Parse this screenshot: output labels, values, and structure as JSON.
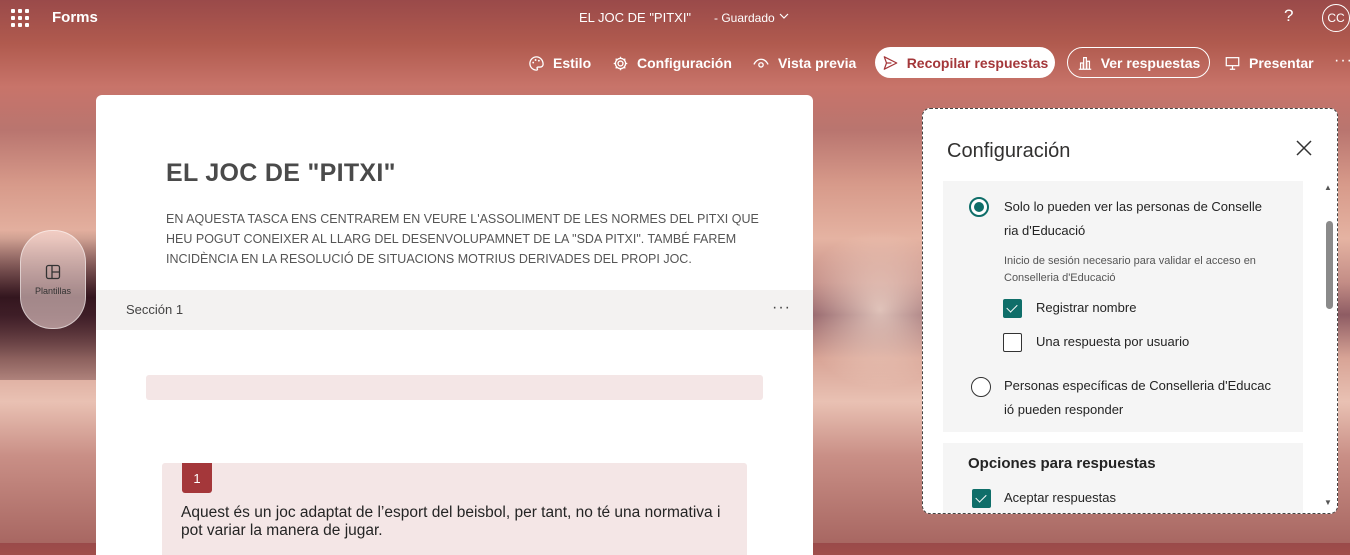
{
  "app": {
    "name": "Forms",
    "doc_title": "EL JOC DE \"PITXI\"",
    "doc_status": "-  Guardado",
    "help": "?",
    "avatar": "CC"
  },
  "toolbar": {
    "style_label": "Estilo",
    "config_label": "Configuración",
    "preview_label": "Vista previa",
    "collect_label": "Recopilar respuestas",
    "responses_label": "Ver respuestas",
    "present_label": "Presentar",
    "more": "···"
  },
  "templates": {
    "label": "Plantillas"
  },
  "form": {
    "title": "EL JOC DE \"PITXI\"",
    "description": "EN AQUESTA TASCA ENS CENTRAREM EN VEURE L'ASSOLIMENT DE LES NORMES DEL PITXI QUE HEU POGUT CONEIXER AL LLARG DEL DESENVOLUPAMNET DE LA \"SDA PITXI\". TAMBÉ FAREM INCIDÈNCIA EN LA RESOLUCIÓ DE SITUACIONS  MOTRIUS DERIVADES DEL PROPI JOC.",
    "section_label": "Sección 1",
    "section_more": "···",
    "question": {
      "number": "1",
      "text": "Aquest és un joc adaptat de l’esport del beisbol, per tant, no té una normativa i pot variar la manera de jugar."
    }
  },
  "settings": {
    "title": "Configuración",
    "option_org_only": "Solo lo pueden ver las personas de Conselleria d'Educació",
    "option_org_only_line1": "Solo lo pueden ver las personas de Conselle",
    "option_org_only_line2": "ria d'Educació",
    "org_hint_line1": "Inicio de sesión necesario para validar el acceso en",
    "org_hint_line2": "Conselleria d'Educació",
    "record_name": "Registrar nombre",
    "record_name_checked": true,
    "one_response": "Una respuesta por usuario",
    "one_response_checked": false,
    "option_specific_line1": "Personas específicas de Conselleria d'Educac",
    "option_specific_line2": "ió pueden responder",
    "response_options_title": "Opciones para respuestas",
    "accept_responses": "Aceptar respuestas",
    "accept_responses_checked": true
  },
  "colors": {
    "accent": "#a4373a",
    "check": "#0f6e69"
  }
}
